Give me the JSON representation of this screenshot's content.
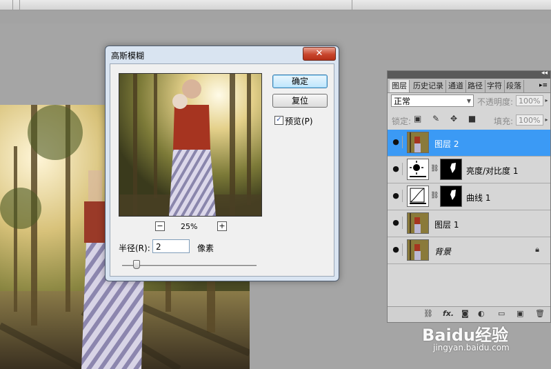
{
  "dialog": {
    "title": "高斯模糊",
    "close_glyph": "✕",
    "ok_label": "确定",
    "reset_label": "复位",
    "preview_label": "预览(P)",
    "preview_checked": true,
    "zoom_minus": "−",
    "zoom_plus": "+",
    "zoom_value": "25%",
    "radius_label": "半径(R):",
    "radius_value": "2",
    "radius_unit": "像素"
  },
  "layers_panel": {
    "collapse_glyph": "◂◂",
    "tabs": [
      "图层",
      "历史记录",
      "通道",
      "路径",
      "字符",
      "段落"
    ],
    "menu_glyph": "▸≡",
    "blend_mode": "正常",
    "opacity_label": "不透明度:",
    "opacity_value": "100%",
    "lock_label": "锁定:",
    "fill_label": "填充:",
    "fill_value": "100%",
    "layers": [
      {
        "name": "图层 2",
        "selected": true
      },
      {
        "name": "亮度/对比度 1",
        "selected": false
      },
      {
        "name": "曲线 1",
        "selected": false
      },
      {
        "name": "图层 1",
        "selected": false
      },
      {
        "name": "背景",
        "selected": false,
        "locked": true
      }
    ],
    "bottom_icons": [
      "link-icon",
      "fx-icon",
      "mask-icon",
      "adjustment-icon",
      "group-icon",
      "new-layer-icon",
      "trash-icon"
    ],
    "bottom_fx": "fx."
  },
  "watermark": {
    "brand": "Baidu经验",
    "url": "jingyan.baidu.com"
  },
  "colors": {
    "selected_layer": "#3b9af5",
    "dialog_frame": "#d9e4f1",
    "close_button": "#c8452c"
  }
}
